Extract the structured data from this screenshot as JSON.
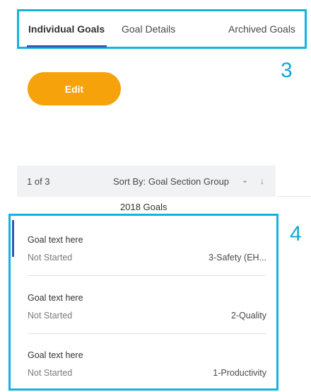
{
  "tabs": [
    {
      "label": "Individual Goals",
      "active": true
    },
    {
      "label": "Goal Details",
      "active": false
    },
    {
      "label": "Archived Goals",
      "active": false
    }
  ],
  "annotations": {
    "tabs_marker": "3",
    "list_marker": "4"
  },
  "actions": {
    "edit_label": "Edit"
  },
  "list_header": {
    "count": "1 of 3",
    "sort_label": "Sort By: Goal Section Group"
  },
  "group": {
    "label": "2018 Goals"
  },
  "goals": [
    {
      "title": "Goal text here",
      "status": "Not Started",
      "section": "3-Safety (EH..."
    },
    {
      "title": "Goal text here",
      "status": "Not Started",
      "section": "2-Quality"
    },
    {
      "title": "Goal text here",
      "status": "Not Started",
      "section": "1-Productivity"
    }
  ],
  "colors": {
    "accent_blue": "#2d5bb5",
    "annotation_cyan": "#12b3df",
    "edit_button": "#f5a20b"
  },
  "icons": {
    "sort_dropdown": "chevron-down-icon",
    "sort_direction": "arrow-down-icon"
  }
}
